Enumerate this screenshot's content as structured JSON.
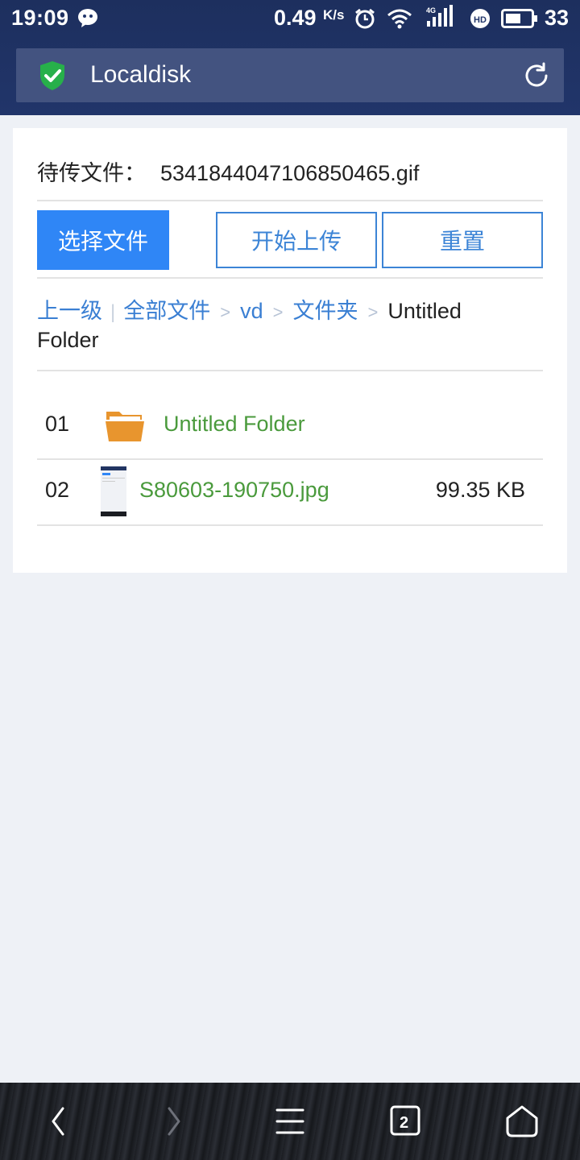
{
  "status_bar": {
    "time": "19:09",
    "net_speed": "0.49",
    "net_speed_unit": "K/s",
    "network_type": "4G",
    "battery": "33"
  },
  "address_bar": {
    "site_title": "Localdisk",
    "secure_icon": "shield-check-icon",
    "reload_icon": "reload-icon"
  },
  "upload": {
    "pending_label": "待传文件：",
    "pending_file": "5341844047106850465.gif",
    "select_button": "选择文件",
    "start_button": "开始上传",
    "reset_button": "重置"
  },
  "breadcrumb": {
    "up": "上一级",
    "items": [
      "全部文件",
      "vd",
      "文件夹"
    ],
    "separator": ">",
    "current": "Untitled Folder"
  },
  "files": [
    {
      "index": "01",
      "name": "Untitled Folder",
      "size": "",
      "type": "folder"
    },
    {
      "index": "02",
      "name": "S80603-190750.jpg",
      "size": "99.35 KB",
      "type": "image"
    }
  ],
  "bottom_nav": {
    "tab_count": "2",
    "icons": [
      "back-icon",
      "forward-icon",
      "menu-icon",
      "tabs-icon",
      "home-icon"
    ]
  },
  "colors": {
    "accent": "#2f86f6",
    "link": "#3a7fd3",
    "file_name": "#4a9a3c",
    "folder": "#e8952e",
    "header": "#1d2f5e"
  }
}
